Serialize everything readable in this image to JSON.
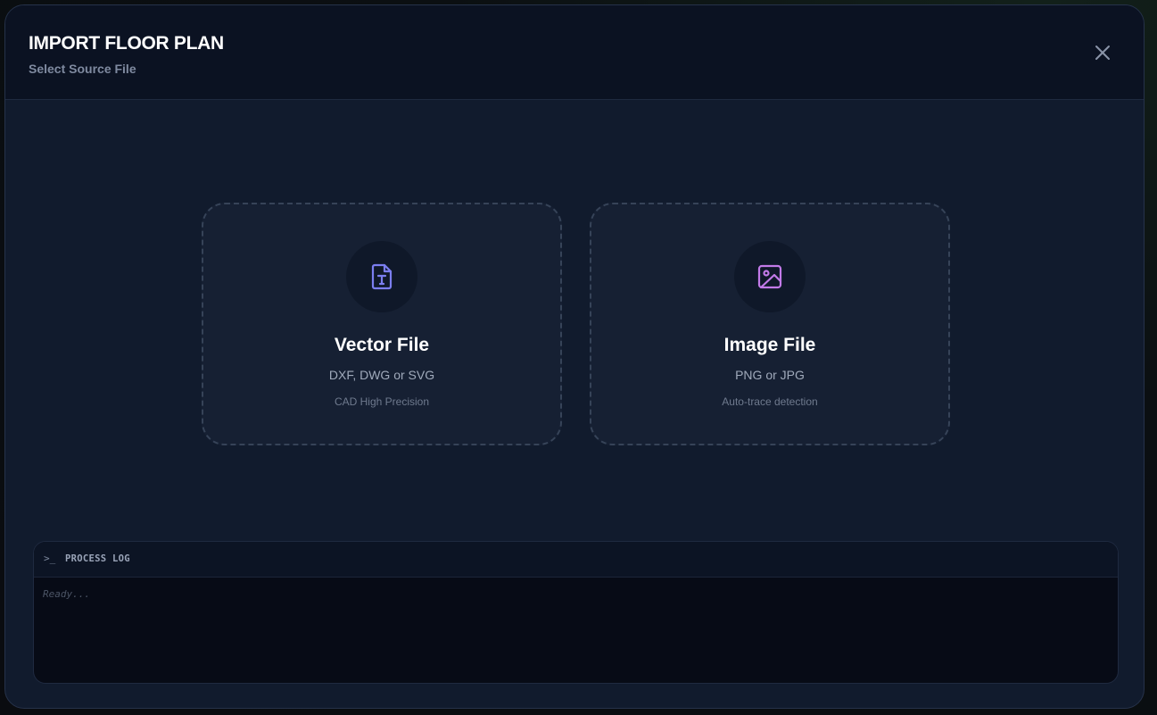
{
  "dialog": {
    "title": "IMPORT FLOOR PLAN",
    "subtitle": "Select Source File",
    "close_icon": "close-icon"
  },
  "options": [
    {
      "title": "Vector File",
      "formats": "DXF, DWG or SVG",
      "note": "CAD High Precision",
      "icon": "file-text-icon",
      "icon_color": "#7b7ef0"
    },
    {
      "title": "Image File",
      "formats": "PNG or JPG",
      "note": "Auto-trace detection",
      "icon": "image-icon",
      "icon_color": "#c27ae8"
    }
  ],
  "log": {
    "prompt": ">_",
    "title": "PROCESS LOG",
    "status": "Ready..."
  }
}
